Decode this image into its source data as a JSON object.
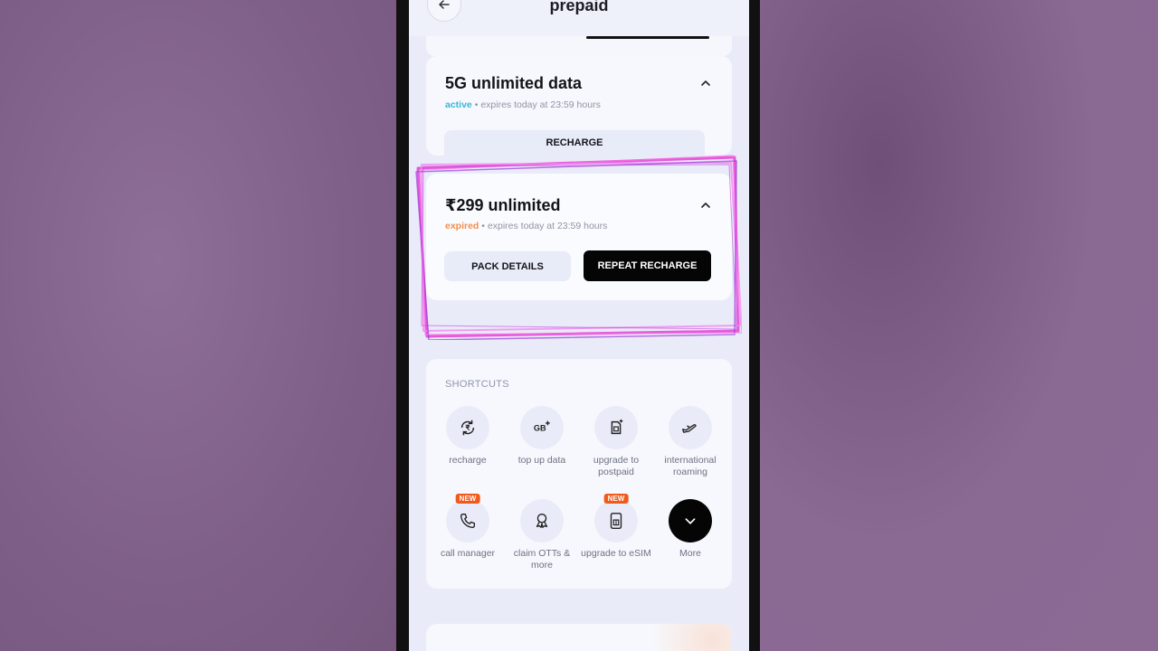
{
  "header": {
    "title": "prepaid",
    "back_icon": "arrow-left-icon"
  },
  "packs": [
    {
      "title": "5G unlimited data",
      "status": "active",
      "separator": "•",
      "expiry": "expires today at 23:59 hours",
      "button": "RECHARGE",
      "status_color": "#37b7d8"
    },
    {
      "title": "₹299 unlimited",
      "status": "expired",
      "separator": "•",
      "expiry": "expires today at 23:59 hours",
      "button_secondary": "PACK DETAILS",
      "button_primary": "REPEAT RECHARGE",
      "status_color": "#ef8e4e"
    }
  ],
  "shortcuts": {
    "label": "SHORTCUTS",
    "items": [
      {
        "label": "recharge",
        "icon": "rupee-refresh-icon"
      },
      {
        "label": "top up data",
        "icon": "gb-plus-icon"
      },
      {
        "label": "upgrade to postpaid",
        "icon": "sim-plus-icon"
      },
      {
        "label": "international roaming",
        "icon": "airplane-icon"
      },
      {
        "label": "call manager",
        "icon": "phone-icon",
        "badge": "NEW"
      },
      {
        "label": "claim OTTs & more",
        "icon": "award-ribbon-icon"
      },
      {
        "label": "upgrade to eSIM",
        "icon": "esim-icon",
        "badge": "NEW"
      },
      {
        "label": "More",
        "icon": "chevron-down-icon"
      }
    ]
  },
  "colors": {
    "highlight": "#e24bd6",
    "accent_dark": "#050505",
    "badge": "#f05a1c"
  }
}
